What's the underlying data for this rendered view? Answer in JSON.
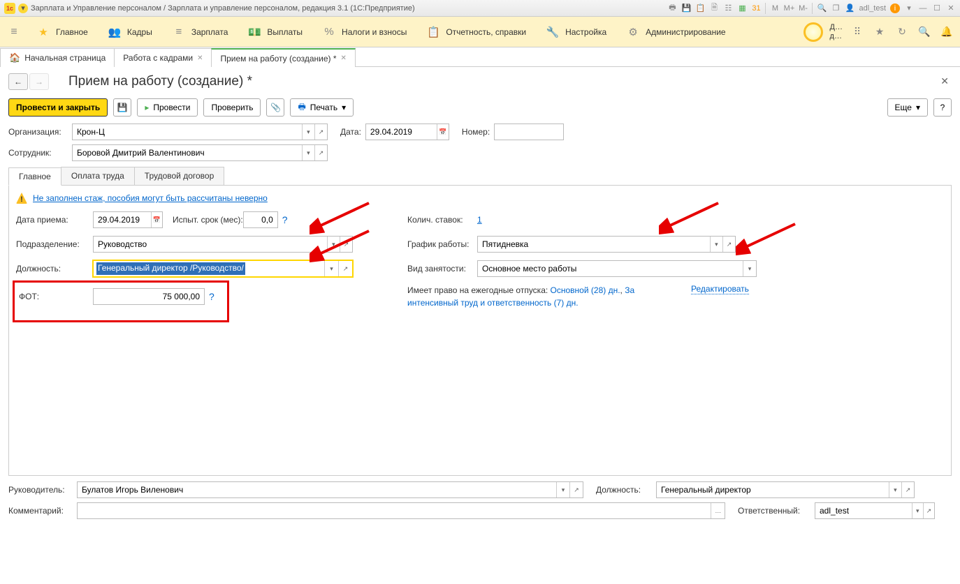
{
  "titlebar": {
    "app_title": "Зарплата и Управление персоналом / Зарплата и управление персоналом, редакция 3.1 (1С:Предприятие)",
    "user": "adl_test"
  },
  "mainmenu": {
    "items": [
      {
        "label": "Главное",
        "icon": "★"
      },
      {
        "label": "Кадры",
        "icon": "👥"
      },
      {
        "label": "Зарплата",
        "icon": "≡"
      },
      {
        "label": "Выплаты",
        "icon": "💵"
      },
      {
        "label": "Налоги и взносы",
        "icon": "%"
      },
      {
        "label": "Отчетность, справки",
        "icon": "📋"
      },
      {
        "label": "Настройка",
        "icon": "🔧"
      },
      {
        "label": "Администрирование",
        "icon": "⚙"
      }
    ],
    "right_label": "Д…\nд…"
  },
  "tabs": [
    {
      "label": "Начальная страница",
      "home": true
    },
    {
      "label": "Работа с кадрами",
      "close": true
    },
    {
      "label": "Прием на работу (создание) *",
      "close": true,
      "active": true
    }
  ],
  "page": {
    "title": "Прием на работу (создание) *"
  },
  "toolbar": {
    "post_close": "Провести и закрыть",
    "post": "Провести",
    "check": "Проверить",
    "print": "Печать",
    "more": "Еще"
  },
  "header": {
    "org_label": "Организация:",
    "org": "Крон-Ц",
    "date_label": "Дата:",
    "date": "29.04.2019",
    "num_label": "Номер:",
    "num": "",
    "emp_label": "Сотрудник:",
    "emp": "Боровой Дмитрий Валентинович"
  },
  "formtabs": [
    "Главное",
    "Оплата труда",
    "Трудовой договор"
  ],
  "warning": {
    "text": "Не заполнен стаж, пособия могут быть рассчитаны неверно"
  },
  "main": {
    "hire_date_label": "Дата приема:",
    "hire_date": "29.04.2019",
    "probation_label": "Испыт. срок (мес):",
    "probation": "0,0",
    "dept_label": "Подразделение:",
    "dept": "Руководство",
    "position_label": "Должность:",
    "position": "Генеральный директор /Руководство/",
    "fot_label": "ФОТ:",
    "fot": "75 000,00",
    "stakes_label": "Колич. ставок:",
    "stakes": "1",
    "schedule_label": "График работы:",
    "schedule": "Пятидневка",
    "emp_type_label": "Вид занятости:",
    "emp_type": "Основное место работы",
    "vacation_prefix": "Имеет право на ежегодные отпуска: ",
    "vacation_main": "Основной (28) дн.",
    "vacation_sep": ", ",
    "vacation_extra": "За интенсивный труд и ответственность (7) дн.",
    "edit_link": "Редактировать"
  },
  "footer": {
    "mgr_label": "Руководитель:",
    "mgr": "Булатов Игорь Виленович",
    "mpos_label": "Должность:",
    "mpos": "Генеральный директор",
    "comment_label": "Комментарий:",
    "comment": "",
    "resp_label": "Ответственный:",
    "resp": "adl_test"
  }
}
